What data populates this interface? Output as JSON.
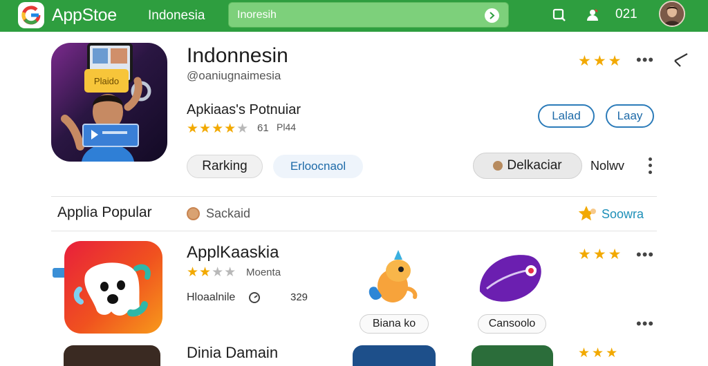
{
  "topbar": {
    "brand": "AppStoe",
    "region": "Indonesia",
    "search_value": "Inoresih",
    "notification_count": "021"
  },
  "hero": {
    "title": "Indonnesin",
    "subtitle": "@oaniugnaimesia",
    "popular_label": "Apkiaas's Potnuiar",
    "rating_value": "61",
    "rating_count": "Pl44",
    "stars": 4,
    "top_stars": 3,
    "button_primary": "Lalad",
    "button_secondary": "Laay",
    "chip_ranking": "Rarking",
    "chip_download": "Erloocnaol",
    "chip_dekkaciar": "Delkaciar",
    "new_label": "Nolwv",
    "icon_banner_top": "Plaido",
    "accent": "#2e9e3f"
  },
  "section": {
    "title": "Applia Popular",
    "middle_label": "Sackaid",
    "right_label": "Soowra"
  },
  "app2": {
    "title": "ApplKaaskia",
    "stars": 2,
    "subtitle": "Moenta",
    "developer": "Hloaalnile",
    "count": "329",
    "top_stars": 3
  },
  "minis": [
    {
      "label": "Biana ko"
    },
    {
      "label": "Cansoolo"
    }
  ],
  "row3": {
    "title": "Dinia Damain"
  }
}
